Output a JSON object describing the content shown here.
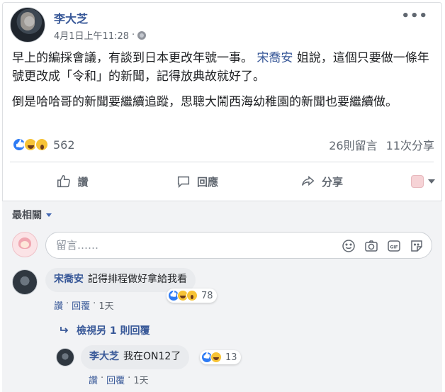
{
  "post": {
    "author": "李大芝",
    "timestamp": "4月1日上午11:28",
    "separator": "·",
    "more_label": "•••",
    "text_p1_a": "早上的編採會議，有談到日本更改年號一事。",
    "text_p1_mention": "宋喬安",
    "text_p1_b": "姐說，這個只要做一條年號更改成「令和」的新聞，記得放典故就好了。",
    "text_p2": "倒是哈哈哥的新聞要繼續追蹤，思聰大鬧西海幼稚園的新聞也要繼續做。",
    "reaction_count": "562",
    "comments_count": "26則留言",
    "shares_count": "11次分享",
    "reaction_icons": [
      "like-icon",
      "haha-icon",
      "wow-icon"
    ]
  },
  "actions": {
    "like": "讚",
    "comment": "回應",
    "share": "分享"
  },
  "comments": {
    "sort_label": "最相關",
    "input_placeholder": "留言……",
    "input_icons": [
      "smiley-icon",
      "camera-icon",
      "gif-icon",
      "sticker-icon"
    ],
    "items": [
      {
        "author": "宋喬安",
        "text": "記得排程做好拿給我看",
        "reactions": "78",
        "like_label": "讚",
        "reply_label": "回覆",
        "time": "1天",
        "dot": "·"
      }
    ],
    "more_replies": "檢視另 1 則回覆",
    "replies": [
      {
        "author": "李大芝",
        "text": "我在ON12了",
        "reactions": "13",
        "like_label": "讚",
        "reply_label": "回覆",
        "time": "1天",
        "dot": "·"
      }
    ]
  },
  "colors": {
    "link": "#385898",
    "like_blue": "#2e7bf4",
    "emoji_yellow": "#f7c336",
    "comment_bg": "#f2f3f5"
  }
}
